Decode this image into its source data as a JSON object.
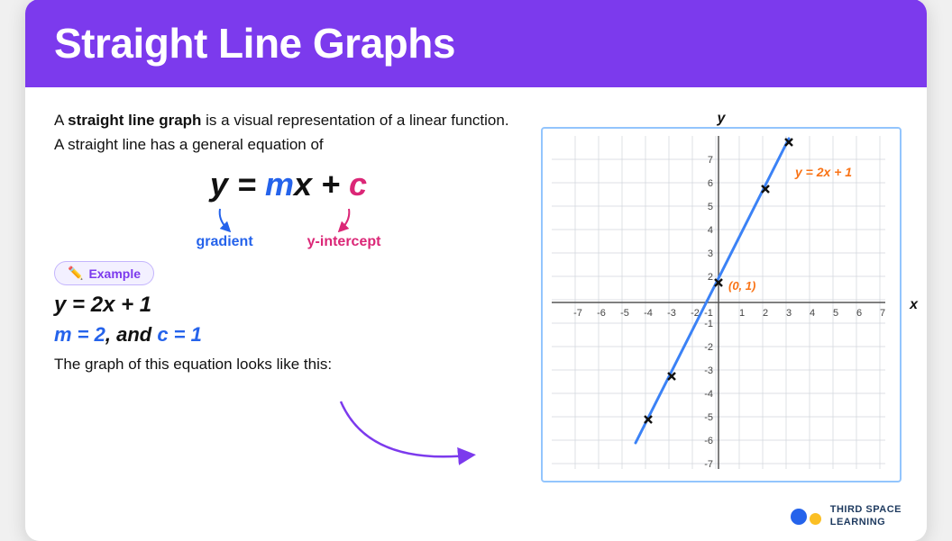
{
  "header": {
    "title": "Straight Line Graphs",
    "bg_color": "#7c3aed"
  },
  "intro": {
    "text1": "A ",
    "bold_term": "straight line graph",
    "text2": " is a visual representation of a linear function.",
    "text3": "A straight line has a general equation of"
  },
  "equation": {
    "main": "y = mx + c",
    "y_part": "y = ",
    "m_part": "m",
    "x_part": "x + ",
    "c_part": "c"
  },
  "labels": {
    "gradient": "gradient",
    "y_intercept": "y-intercept"
  },
  "example_badge": "Example",
  "example": {
    "eq": "y = 2x + 1",
    "vars": "m = 2, and c = 1"
  },
  "bottom_text": "The graph of this equation looks like this:",
  "graph": {
    "x_min": -7,
    "x_max": 7,
    "y_min": -7,
    "y_max": 7,
    "equation_label": "y = 2x + 1",
    "origin_label": "(0, 1)",
    "x_axis_label": "x",
    "y_axis_label": "y",
    "points": [
      {
        "x": -3,
        "y": -5
      },
      {
        "x": -2,
        "y": -3
      },
      {
        "x": 0,
        "y": 1
      },
      {
        "x": 2,
        "y": 5
      },
      {
        "x": 3,
        "y": 7
      }
    ]
  },
  "logo": {
    "line1": "THIRD SPACE",
    "line2": "LEARNING"
  }
}
